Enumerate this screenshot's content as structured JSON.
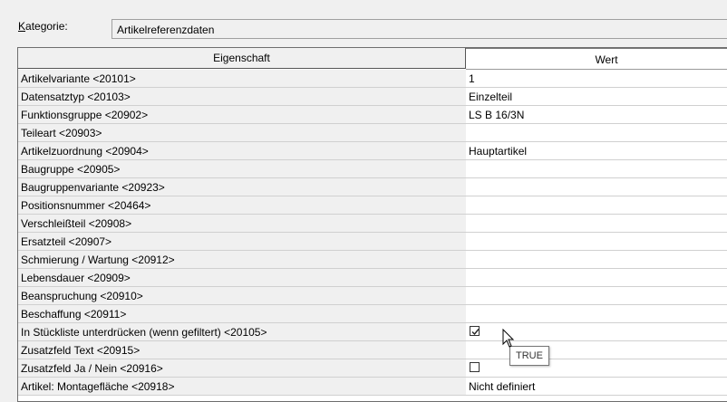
{
  "category": {
    "label_underlined": "K",
    "label_rest": "ategorie:",
    "value": "Artikelreferenzdaten"
  },
  "table": {
    "header_property": "Eigenschaft",
    "header_value": "Wert",
    "rows": [
      {
        "property": "Artikelvariante <20101>",
        "value": "1"
      },
      {
        "property": "Datensatztyp <20103>",
        "value": "Einzelteil"
      },
      {
        "property": "Funktionsgruppe <20902>",
        "value": "LS B 16/3N"
      },
      {
        "property": "Teileart <20903>",
        "value": ""
      },
      {
        "property": "Artikelzuordnung <20904>",
        "value": "Hauptartikel"
      },
      {
        "property": "Baugruppe <20905>",
        "value": ""
      },
      {
        "property": "Baugruppenvariante <20923>",
        "value": ""
      },
      {
        "property": "Positionsnummer <20464>",
        "value": ""
      },
      {
        "property": "Verschleißteil <20908>",
        "value": ""
      },
      {
        "property": "Ersatzteil <20907>",
        "value": ""
      },
      {
        "property": "Schmierung / Wartung <20912>",
        "value": ""
      },
      {
        "property": "Lebensdauer <20909>",
        "value": ""
      },
      {
        "property": "Beanspruchung <20910>",
        "value": ""
      },
      {
        "property": "Beschaffung <20911>",
        "value": ""
      },
      {
        "property": "In Stückliste unterdrücken (wenn gefiltert) <20105>",
        "value": "",
        "checkbox": true,
        "checked": true
      },
      {
        "property": "Zusatzfeld Text <20915>",
        "value": ""
      },
      {
        "property": "Zusatzfeld Ja / Nein <20916>",
        "value": "",
        "checkbox": true,
        "checked": false
      },
      {
        "property": "Artikel: Montagefläche <20918>",
        "value": "Nicht definiert"
      }
    ]
  },
  "tooltip": {
    "text": "TRUE"
  },
  "icons": {
    "checkbox_checked": "check-icon",
    "cursor": "mouse-pointer-icon"
  }
}
